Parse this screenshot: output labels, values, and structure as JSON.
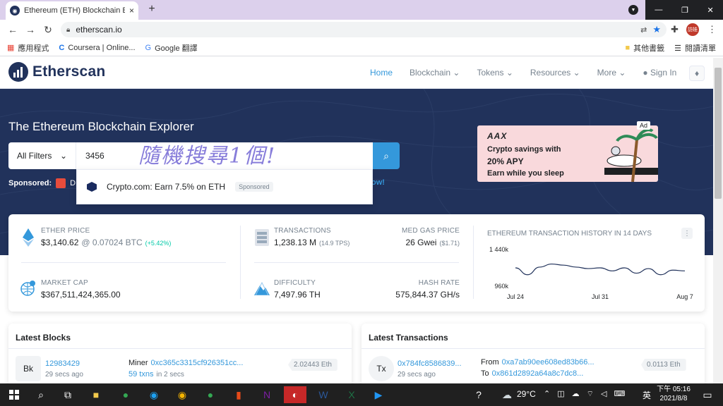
{
  "browser": {
    "tab_title": "Ethereum (ETH) Blockchain Exp",
    "tab_close": "×",
    "new_tab": "+",
    "url": "etherscan.io",
    "profile_label": "訪娃",
    "window_controls": [
      "—",
      "❐",
      "✕"
    ]
  },
  "bookmarks": {
    "items": [
      "應用程式",
      "Coursera | Online...",
      "Google 翻譯"
    ],
    "right": [
      "其他書籤",
      "閱讀清單"
    ]
  },
  "site": {
    "logo": "Etherscan",
    "nav": [
      "Home",
      "Blockchain",
      "Tokens",
      "Resources",
      "More"
    ],
    "sign_in": "Sign In"
  },
  "hero": {
    "title": "The Ethereum Blockchain Explorer",
    "filter": "All Filters",
    "search_value": "3456",
    "handwriting": "隨機搜尋1個!",
    "sponsored_label": "Sponsored:",
    "sponsored_text": "D",
    "sponsored_tail": "ow!",
    "suggestion": "Crypto.com: Earn 7.5% on ETH",
    "suggestion_badge": "Sponsored"
  },
  "ad": {
    "brand": "AAX",
    "line1": "Crypto savings with",
    "line2": "20% APY",
    "line3": "Earn while you sleep",
    "tag": "Ad"
  },
  "stats": {
    "ether_price_label": "ETHER PRICE",
    "ether_price": "$3,140.62",
    "ether_btc": "@ 0.07024 BTC",
    "ether_change": "(+5.42%)",
    "market_cap_label": "MARKET CAP",
    "market_cap": "$367,511,424,365.00",
    "tx_label": "TRANSACTIONS",
    "tx_value": "1,238.13 M",
    "tx_tps": "(14.9 TPS)",
    "gas_label": "MED GAS PRICE",
    "gas_value": "26 Gwei",
    "gas_usd": "($1.71)",
    "difficulty_label": "DIFFICULTY",
    "difficulty_value": "7,497.96 TH",
    "hash_label": "HASH RATE",
    "hash_value": "575,844.37 GH/s",
    "chart_title": "ETHEREUM TRANSACTION HISTORY IN 14 DAYS"
  },
  "chart_data": {
    "type": "line",
    "title": "ETHEREUM TRANSACTION HISTORY IN 14 DAYS",
    "x_ticks": [
      "Jul 24",
      "Jul 31",
      "Aug 7"
    ],
    "y_ticks": [
      "1 440k",
      "960k"
    ],
    "ylim": [
      960000,
      1440000
    ],
    "x": [
      "Jul 24",
      "Jul 25",
      "Jul 26",
      "Jul 27",
      "Jul 28",
      "Jul 29",
      "Jul 30",
      "Jul 31",
      "Aug 1",
      "Aug 2",
      "Aug 3",
      "Aug 4",
      "Aug 5",
      "Aug 6",
      "Aug 7"
    ],
    "values": [
      1200000,
      1110000,
      1210000,
      1250000,
      1235000,
      1210000,
      1190000,
      1200000,
      1160000,
      1200000,
      1130000,
      1190000,
      1110000,
      1170000,
      1160000
    ]
  },
  "latest_blocks": {
    "title": "Latest Blocks",
    "icon": "Bk",
    "block": "12983429",
    "age": "29 secs ago",
    "miner_label": "Miner",
    "miner": "0xc365c3315cf926351cc...",
    "txns": "59 txns",
    "txns_time": "in 2 secs",
    "reward": "2.02443 Eth"
  },
  "latest_tx": {
    "title": "Latest Transactions",
    "icon": "Tx",
    "hash": "0x784fc8586839...",
    "age": "29 secs ago",
    "from_label": "From",
    "from": "0xa7ab90ee608ed83b66...",
    "to_label": "To",
    "to": "0x861d2892a64a8c7dc8...",
    "amount": "0.0113 Eth"
  },
  "taskbar": {
    "weather": "29°C",
    "ime": "英",
    "time": "下午 05:16",
    "date": "2021/8/8"
  },
  "colors": {
    "hero": "#21325b",
    "accent": "#3498db",
    "positive": "#00c9a7"
  }
}
